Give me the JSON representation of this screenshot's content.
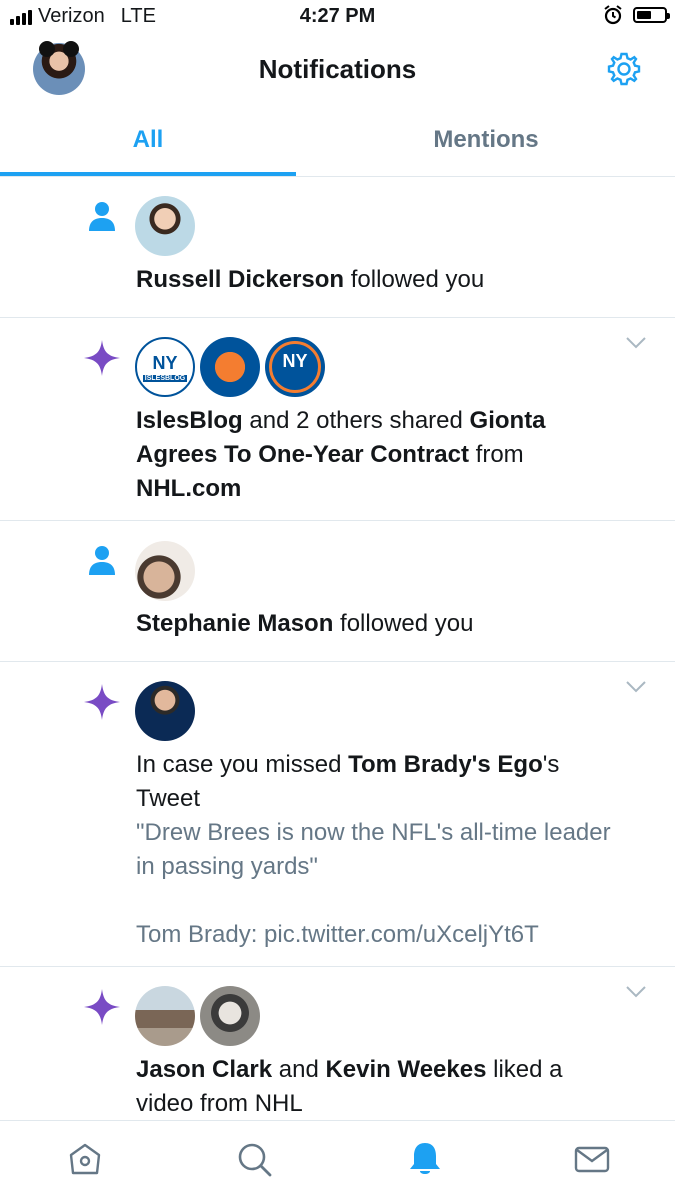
{
  "status_bar": {
    "carrier": "Verizon",
    "network": "LTE",
    "time": "4:27 PM",
    "battery_level": 0.55,
    "icons": [
      "signal-icon",
      "alarm-icon",
      "battery-icon"
    ]
  },
  "header": {
    "title": "Notifications",
    "avatar_icon": "profile-avatar",
    "settings_icon": "gear-icon"
  },
  "tabs": [
    {
      "label": "All",
      "active": true
    },
    {
      "label": "Mentions",
      "active": false
    }
  ],
  "notifications": [
    {
      "type": "follow",
      "icon": "person-icon",
      "name": "Russell Dickerson",
      "action": " followed you"
    },
    {
      "type": "shared",
      "icon": "sparkle-icon",
      "avatars": [
        {
          "name": "IslesBlog",
          "label": "NY",
          "sublabel": "ISLESBLOG"
        },
        {
          "name": "fury-logo"
        },
        {
          "name": "islanders-logo",
          "label": "NY"
        }
      ],
      "actor": "IslesBlog",
      "middle": " and 2 others shared ",
      "article": "Gionta Agrees To One-Year Contract",
      "from_text": " from ",
      "source": "NHL.com"
    },
    {
      "type": "follow",
      "icon": "person-icon",
      "name": "Stephanie Mason",
      "action": " followed you"
    },
    {
      "type": "missed",
      "icon": "sparkle-icon",
      "prefix": "In case you missed ",
      "account": "Tom Brady's Ego",
      "suffix": "'s Tweet",
      "quote_line1": "\"Drew Brees is now the NFL's all-time leader in passing yards\"",
      "quote_line2": "Tom Brady: pic.twitter.com/uXceljYt6T"
    },
    {
      "type": "liked",
      "icon": "sparkle-icon",
      "actor1": "Jason Clark",
      "and_text": " and ",
      "actor2": "Kevin Weekes",
      "action": " liked a video from NHL"
    }
  ],
  "tabbar": [
    {
      "name": "home",
      "icon": "home-icon"
    },
    {
      "name": "search",
      "icon": "search-icon"
    },
    {
      "name": "notifications",
      "icon": "bell-icon",
      "active": true
    },
    {
      "name": "messages",
      "icon": "mail-icon"
    }
  ],
  "colors": {
    "accent": "#1da1f2",
    "sparkle": "#794bc4",
    "secondary_text": "#657786",
    "divider": "#e1e8ed"
  }
}
